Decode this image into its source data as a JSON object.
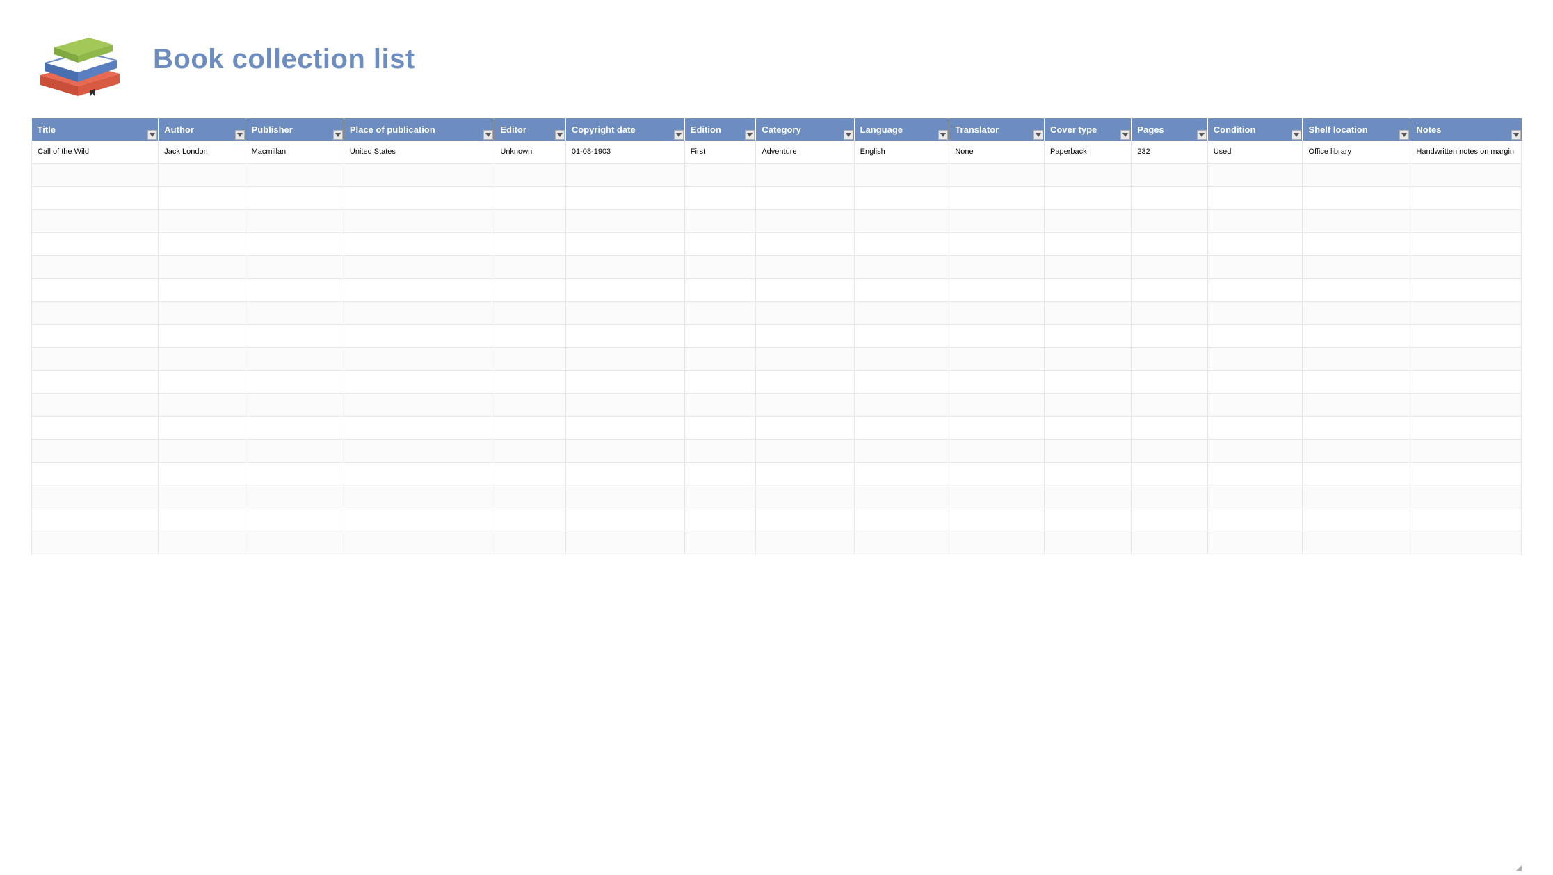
{
  "header": {
    "title": "Book collection list"
  },
  "columns": [
    {
      "key": "title",
      "label": "Title"
    },
    {
      "key": "author",
      "label": "Author"
    },
    {
      "key": "publisher",
      "label": "Publisher"
    },
    {
      "key": "place",
      "label": "Place of publication"
    },
    {
      "key": "editor",
      "label": "Editor"
    },
    {
      "key": "copyright",
      "label": "Copyright date"
    },
    {
      "key": "edition",
      "label": "Edition"
    },
    {
      "key": "category",
      "label": "Category"
    },
    {
      "key": "language",
      "label": "Language"
    },
    {
      "key": "translator",
      "label": "Translator"
    },
    {
      "key": "covertype",
      "label": "Cover type"
    },
    {
      "key": "pages",
      "label": "Pages"
    },
    {
      "key": "condition",
      "label": "Condition"
    },
    {
      "key": "shelf",
      "label": "Shelf location"
    },
    {
      "key": "notes",
      "label": "Notes"
    }
  ],
  "rows": [
    {
      "title": "Call of the Wild",
      "author": "Jack London",
      "publisher": "Macmillan",
      "place": "United States",
      "editor": "Unknown",
      "copyright": "01-08-1903",
      "edition": "First",
      "category": "Adventure",
      "language": "English",
      "translator": "None",
      "covertype": "Paperback",
      "pages": "232",
      "condition": "Used",
      "shelf": "Office library",
      "notes": "Handwritten notes on margin"
    }
  ],
  "empty_row_count": 17,
  "colors": {
    "header_bg": "#6d8dc0",
    "title_color": "#6d8dc0"
  }
}
